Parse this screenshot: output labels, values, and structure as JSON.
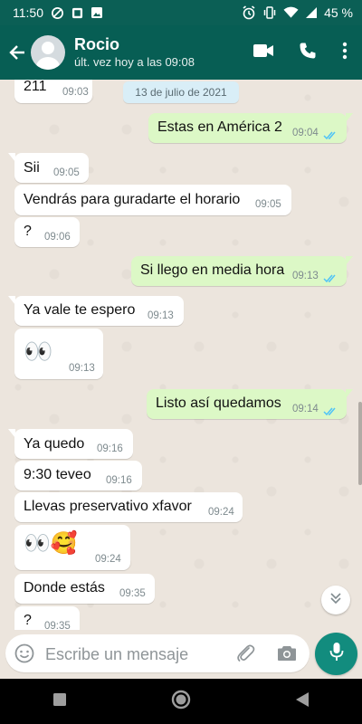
{
  "status_bar": {
    "time": "11:50",
    "battery": "45 %"
  },
  "header": {
    "contact_name": "Rocio",
    "last_seen": "últ. vez hoy a las 09:08",
    "icons": [
      "back-arrow-icon",
      "video-call-icon",
      "phone-call-icon",
      "more-vert-icon"
    ]
  },
  "chat": {
    "date_chip": "13 de julio de 2021",
    "messages": [
      {
        "dir": "in",
        "text": "211",
        "time": "09:03"
      },
      {
        "dir": "out",
        "text": "Estas en América 2",
        "time": "09:04",
        "read": true
      },
      {
        "dir": "in",
        "text": "Sii",
        "time": "09:05"
      },
      {
        "dir": "in",
        "text": "Vendrás para guradarte el horario",
        "time": "09:05"
      },
      {
        "dir": "in",
        "text": "?",
        "time": "09:06"
      },
      {
        "dir": "out",
        "text": "Si llego en media hora",
        "time": "09:13",
        "read": true
      },
      {
        "dir": "in",
        "text": "Ya vale te espero",
        "time": "09:13"
      },
      {
        "dir": "in",
        "text": "👀",
        "time": "09:13"
      },
      {
        "dir": "out",
        "text": "Listo así quedamos",
        "time": "09:14",
        "read": true
      },
      {
        "dir": "in",
        "text": "Ya quedo",
        "time": "09:16"
      },
      {
        "dir": "in",
        "text": "9:30 teveo",
        "time": "09:16"
      },
      {
        "dir": "in",
        "text": "Llevas preservativo xfavor",
        "time": "09:24"
      },
      {
        "dir": "in",
        "text": "👀🥰",
        "time": "09:24"
      },
      {
        "dir": "in",
        "text": "Donde estás",
        "time": "09:35"
      },
      {
        "dir": "in",
        "text": "?",
        "time": "09:35"
      }
    ]
  },
  "input": {
    "placeholder": "Escribe un mensaje"
  },
  "colors": {
    "header": "#075e54",
    "outgoing_bubble": "#dcf8c6",
    "incoming_bubble": "#ffffff",
    "chat_bg": "#ece5dd",
    "read_ticks": "#4fc3f7",
    "mic_button": "#128c7e"
  }
}
